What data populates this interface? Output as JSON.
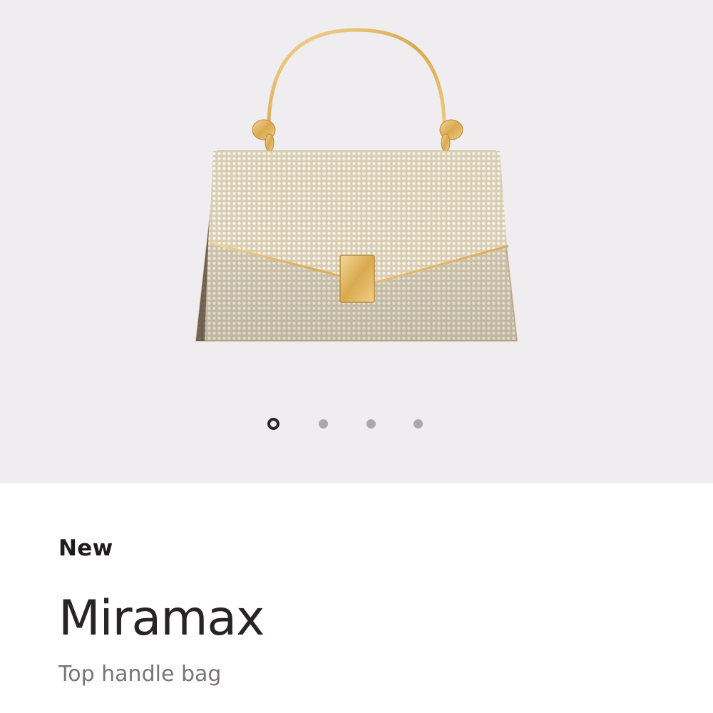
{
  "gallery": {
    "background_color": "#efedf0",
    "image_description_icon": "handbag-image",
    "total_slides": 4,
    "active_slide": 1,
    "slides": [
      {
        "name": "slide-1",
        "active": true
      },
      {
        "name": "slide-2",
        "active": false
      },
      {
        "name": "slide-3",
        "active": false
      },
      {
        "name": "slide-4",
        "active": false
      }
    ]
  },
  "product": {
    "badge": "New",
    "name": "Miramax",
    "category": "Top handle bag"
  },
  "colors": {
    "title": "#2a2325",
    "subtitle": "#7a7477",
    "dot_active": "#2a2426",
    "dot_inactive": "#a9a8ab"
  }
}
